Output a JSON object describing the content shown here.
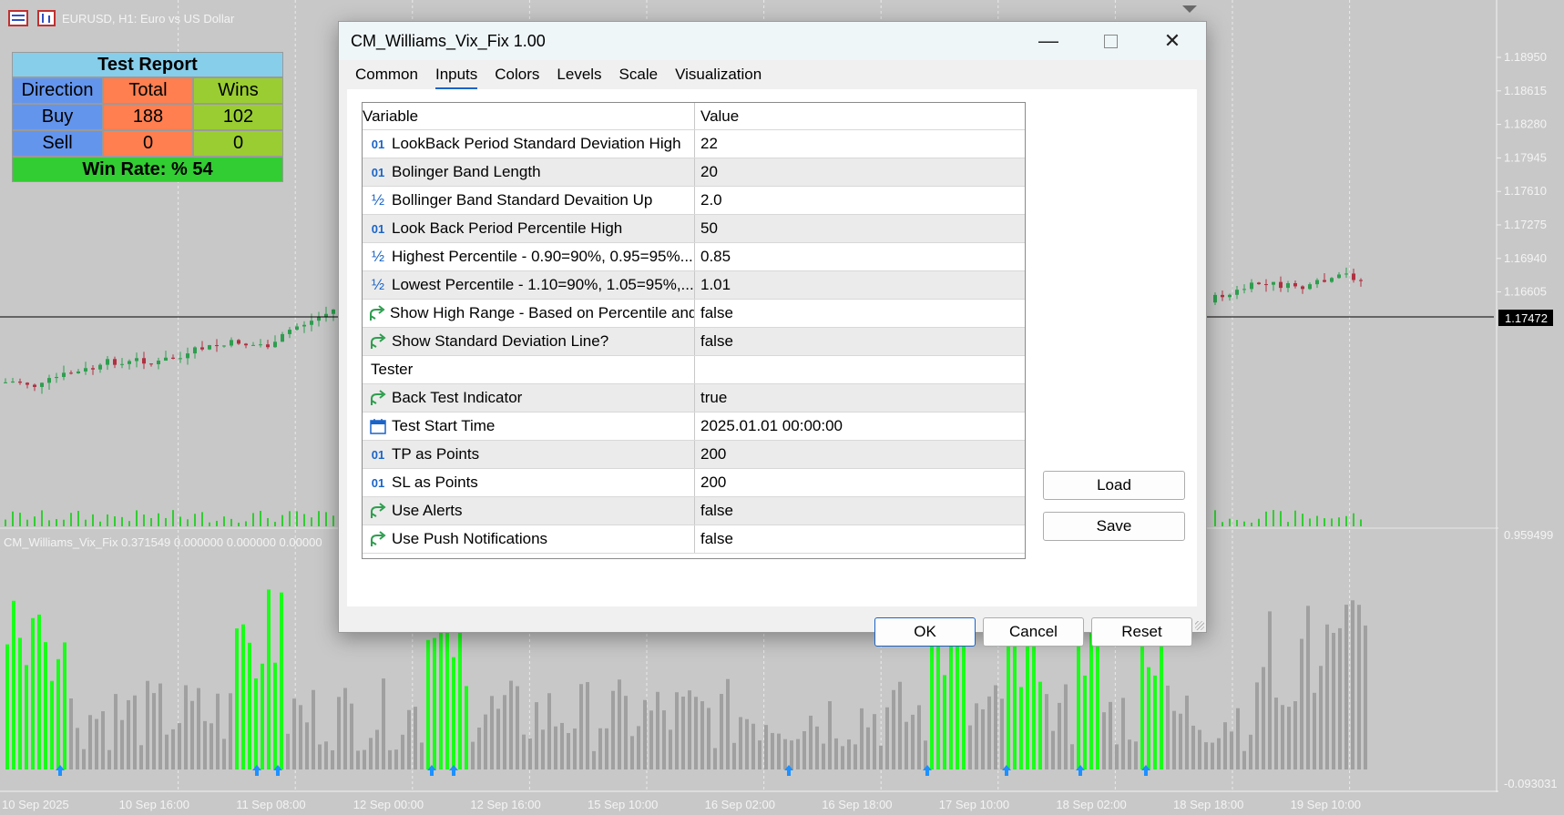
{
  "chart": {
    "symbol_title": "EURUSD, H1:  Euro vs US Dollar",
    "indicator_label": "CM_Williams_Vix_Fix 0.371549 0.000000 0.000000 0.00000",
    "price_labels": [
      "1.18950",
      "1.18615",
      "1.18280",
      "1.17945",
      "1.17610",
      "1.17275",
      "1.16940",
      "1.16605"
    ],
    "current_price": "1.17472",
    "indicator_scale": [
      "0.959499",
      "-0.093031"
    ],
    "time_labels": [
      "10 Sep 2025",
      "10 Sep 16:00",
      "11 Sep 08:00",
      "12 Sep 00:00",
      "12 Sep 16:00",
      "15 Sep 10:00",
      "16 Sep 02:00",
      "16 Sep 18:00",
      "17 Sep 10:00",
      "18 Sep 02:00",
      "18 Sep 18:00",
      "19 Sep 10:00"
    ],
    "colors": {
      "up": "#2e9e4f",
      "down": "#b03040",
      "signal_bar": "#1aff1a",
      "normal_bar": "#a0a0a0",
      "arrow": "#1e90ff"
    }
  },
  "report": {
    "title": "Test Report",
    "headers": [
      "Direction",
      "Total",
      "Wins"
    ],
    "rows": [
      [
        "Buy",
        "188",
        "102"
      ],
      [
        "Sell",
        "0",
        "0"
      ]
    ],
    "footer": "Win Rate: %  54"
  },
  "dialog": {
    "title": "CM_Williams_Vix_Fix 1.00",
    "tabs": [
      "Common",
      "Inputs",
      "Colors",
      "Levels",
      "Scale",
      "Visualization"
    ],
    "active_tab": "Inputs",
    "columns": [
      "Variable",
      "Value"
    ],
    "params": [
      {
        "icon": "int-icon",
        "name": "LookBack Period Standard Deviation High",
        "value": "22"
      },
      {
        "icon": "int-icon",
        "name": "Bolinger Band Length",
        "value": "20"
      },
      {
        "icon": "double-icon",
        "name": "Bollinger Band Standard Devaition Up",
        "value": "2.0"
      },
      {
        "icon": "int-icon",
        "name": "Look Back Period Percentile High",
        "value": "50"
      },
      {
        "icon": "double-icon",
        "name": "Highest Percentile - 0.90=90%, 0.95=95%...",
        "value": "0.85"
      },
      {
        "icon": "double-icon",
        "name": "Lowest Percentile - 1.10=90%, 1.05=95%,...",
        "value": "1.01"
      },
      {
        "icon": "bool-icon",
        "name": "Show High Range - Based on Percentile and...",
        "value": "false"
      },
      {
        "icon": "bool-icon",
        "name": "Show Standard Deviation Line?",
        "value": "false"
      },
      {
        "icon": "",
        "name": "Tester",
        "value": ""
      },
      {
        "icon": "bool-icon",
        "name": "Back Test Indicator",
        "value": "true"
      },
      {
        "icon": "calendar-icon",
        "name": "Test Start Time",
        "value": "2025.01.01 00:00:00"
      },
      {
        "icon": "int-icon",
        "name": "TP as Points",
        "value": "200"
      },
      {
        "icon": "int-icon",
        "name": "SL as Points",
        "value": "200"
      },
      {
        "icon": "bool-icon",
        "name": "Use Alerts",
        "value": "false"
      },
      {
        "icon": "bool-icon",
        "name": "Use Push Notifications",
        "value": "false"
      }
    ],
    "int_glyph": "01",
    "double_glyph": "½",
    "buttons": {
      "load": "Load",
      "save": "Save",
      "ok": "OK",
      "cancel": "Cancel",
      "reset": "Reset"
    }
  }
}
